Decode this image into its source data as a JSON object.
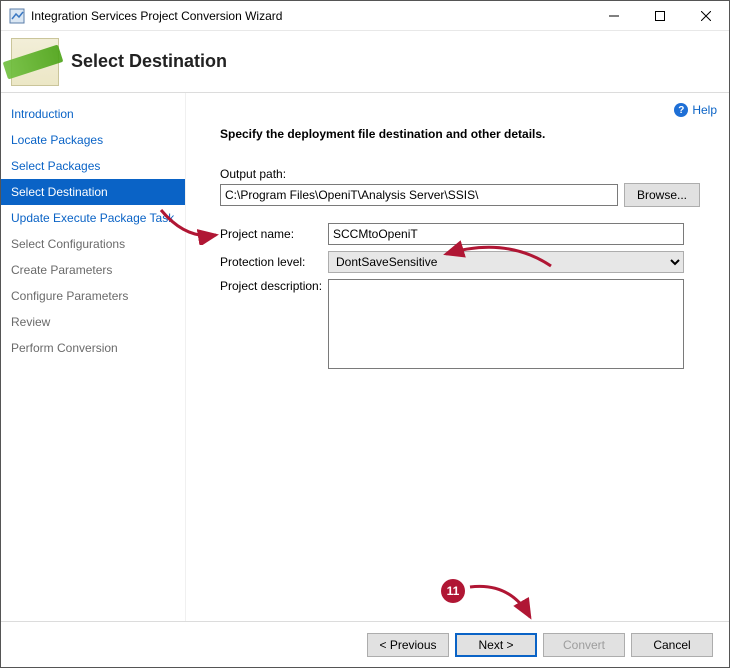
{
  "window": {
    "title": "Integration Services Project Conversion Wizard"
  },
  "header": {
    "title": "Select Destination"
  },
  "help": {
    "label": "Help"
  },
  "sidebar": {
    "items": [
      {
        "label": "Introduction",
        "state": "link"
      },
      {
        "label": "Locate Packages",
        "state": "link"
      },
      {
        "label": "Select Packages",
        "state": "link"
      },
      {
        "label": "Select Destination",
        "state": "selected"
      },
      {
        "label": "Update Execute Package Task",
        "state": "link"
      },
      {
        "label": "Select Configurations",
        "state": "disabled"
      },
      {
        "label": "Create Parameters",
        "state": "disabled"
      },
      {
        "label": "Configure Parameters",
        "state": "disabled"
      },
      {
        "label": "Review",
        "state": "disabled"
      },
      {
        "label": "Perform Conversion",
        "state": "disabled"
      }
    ]
  },
  "content": {
    "instruction": "Specify the deployment file destination and other details.",
    "labels": {
      "output_path": "Output path:",
      "project_name": "Project name:",
      "protection_level": "Protection level:",
      "project_description": "Project description:"
    },
    "values": {
      "output_path": "C:\\Program Files\\OpeniT\\Analysis Server\\SSIS\\",
      "project_name": "SCCMtoOpeniT",
      "protection_level": "DontSaveSensitive",
      "project_description": ""
    },
    "buttons": {
      "browse": "Browse..."
    }
  },
  "footer": {
    "previous": "< Previous",
    "next": "Next >",
    "convert": "Convert",
    "cancel": "Cancel"
  },
  "annotation": {
    "step": "11"
  }
}
